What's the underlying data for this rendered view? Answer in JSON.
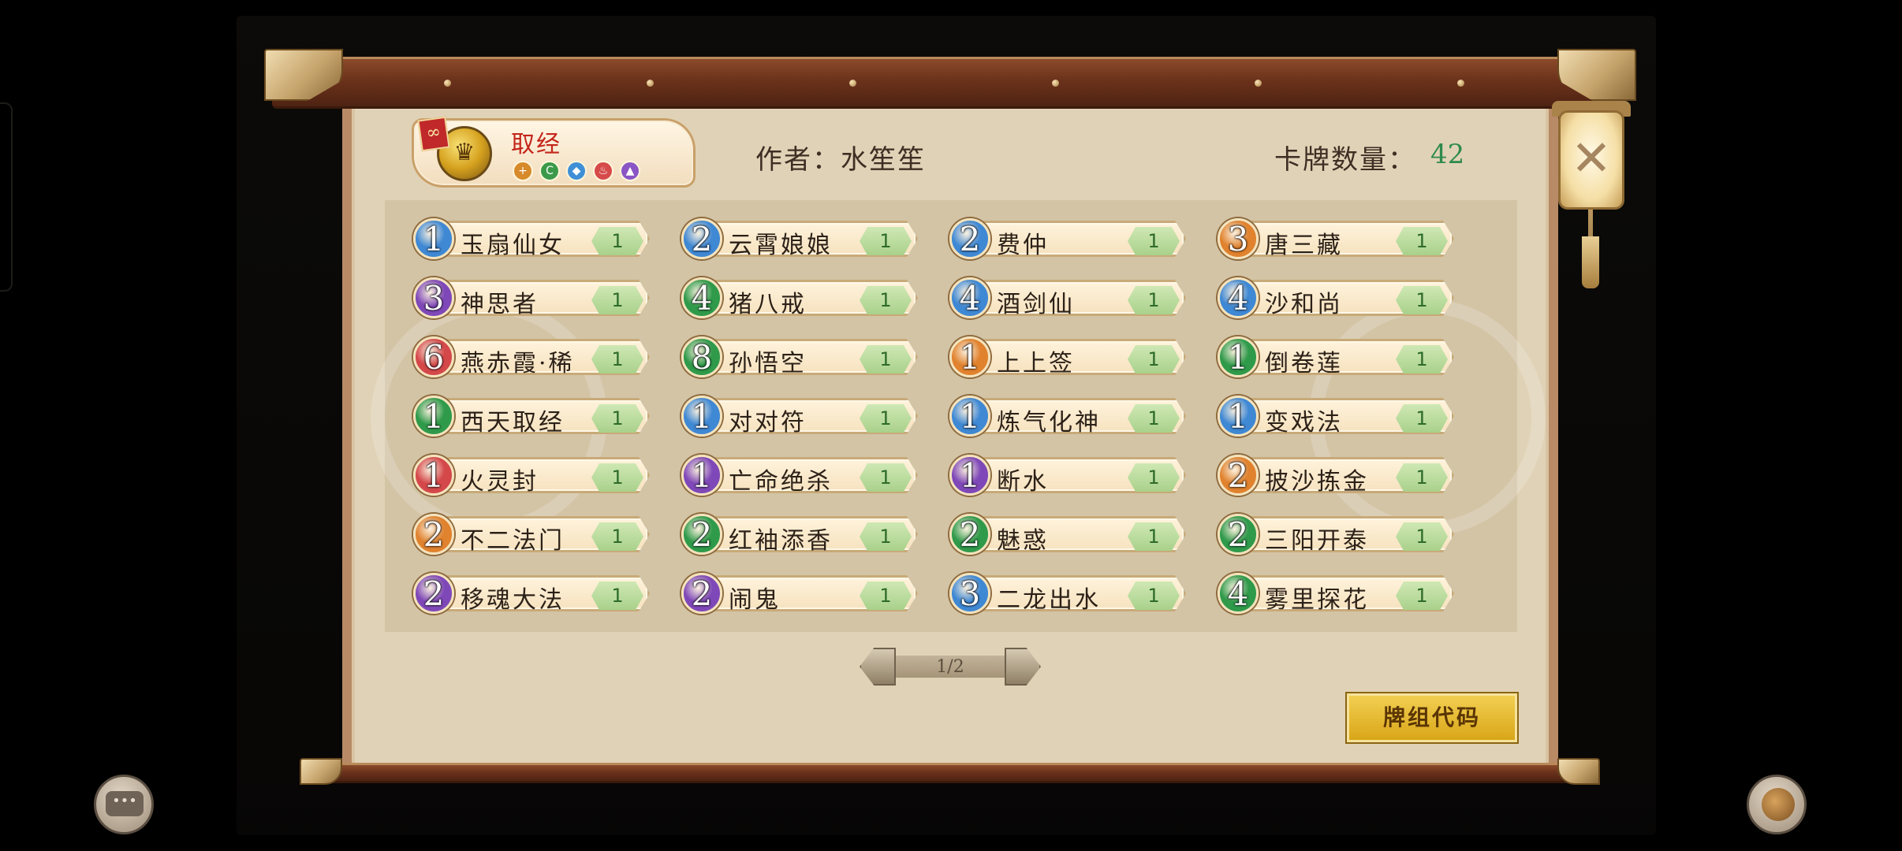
{
  "deck": {
    "name": "取经",
    "badge_icon": "link-icon",
    "elements": [
      {
        "name": "gold",
        "symbol": "+",
        "color": "#d68a2a"
      },
      {
        "name": "wood",
        "symbol": "C",
        "color": "#3b9a4a"
      },
      {
        "name": "water",
        "symbol": "◆",
        "color": "#3e8fd6"
      },
      {
        "name": "fire",
        "symbol": "♨",
        "color": "#d64a4a"
      },
      {
        "name": "earth",
        "symbol": "▲",
        "color": "#8a55c4"
      }
    ],
    "author": "作者：水笙笙",
    "card_count_label": "卡牌数量：",
    "card_count": "42"
  },
  "cost_colors": {
    "blue": "#3f88d4",
    "purple": "#7f48b8",
    "green": "#2f9a4a",
    "orange": "#e0822e",
    "red": "#d4484a"
  },
  "cards": [
    {
      "cost": "1",
      "color": "blue",
      "name": "玉扇仙女",
      "qty": "1"
    },
    {
      "cost": "2",
      "color": "blue",
      "name": "云霄娘娘",
      "qty": "1"
    },
    {
      "cost": "2",
      "color": "blue",
      "name": "费仲",
      "qty": "1"
    },
    {
      "cost": "3",
      "color": "orange",
      "name": "唐三藏",
      "qty": "1"
    },
    {
      "cost": "3",
      "color": "purple",
      "name": "神思者",
      "qty": "1"
    },
    {
      "cost": "4",
      "color": "green",
      "name": "猪八戒",
      "qty": "1"
    },
    {
      "cost": "4",
      "color": "blue",
      "name": "酒剑仙",
      "qty": "1"
    },
    {
      "cost": "4",
      "color": "blue",
      "name": "沙和尚",
      "qty": "1"
    },
    {
      "cost": "6",
      "color": "red",
      "name": "燕赤霞·稀",
      "qty": "1"
    },
    {
      "cost": "8",
      "color": "green",
      "name": "孙悟空",
      "qty": "1"
    },
    {
      "cost": "1",
      "color": "orange",
      "name": "上上签",
      "qty": "1"
    },
    {
      "cost": "1",
      "color": "green",
      "name": "倒卷莲",
      "qty": "1"
    },
    {
      "cost": "1",
      "color": "green",
      "name": "西天取经",
      "qty": "1"
    },
    {
      "cost": "1",
      "color": "blue",
      "name": "对对符",
      "qty": "1"
    },
    {
      "cost": "1",
      "color": "blue",
      "name": "炼气化神",
      "qty": "1"
    },
    {
      "cost": "1",
      "color": "blue",
      "name": "变戏法",
      "qty": "1"
    },
    {
      "cost": "1",
      "color": "red",
      "name": "火灵封",
      "qty": "1"
    },
    {
      "cost": "1",
      "color": "purple",
      "name": "亡命绝杀",
      "qty": "1"
    },
    {
      "cost": "1",
      "color": "purple",
      "name": "断水",
      "qty": "1"
    },
    {
      "cost": "2",
      "color": "orange",
      "name": "披沙拣金",
      "qty": "1"
    },
    {
      "cost": "2",
      "color": "orange",
      "name": "不二法门",
      "qty": "1"
    },
    {
      "cost": "2",
      "color": "green",
      "name": "红袖添香",
      "qty": "1"
    },
    {
      "cost": "2",
      "color": "green",
      "name": "魅惑",
      "qty": "1"
    },
    {
      "cost": "2",
      "color": "green",
      "name": "三阳开泰",
      "qty": "1"
    },
    {
      "cost": "2",
      "color": "purple",
      "name": "移魂大法",
      "qty": "1"
    },
    {
      "cost": "2",
      "color": "purple",
      "name": "闹鬼",
      "qty": "1"
    },
    {
      "cost": "3",
      "color": "blue",
      "name": "二龙出水",
      "qty": "1"
    },
    {
      "cost": "4",
      "color": "green",
      "name": "雾里探花",
      "qty": "1"
    }
  ],
  "pagination": {
    "text": "1/2"
  },
  "deck_code_button": "牌组代码",
  "chat_button_icon": "chat-bubble-icon",
  "chat_glyph": "•••",
  "food_button_icon": "food-icon",
  "close_icon": "close-icon",
  "close_glyph": "✕"
}
